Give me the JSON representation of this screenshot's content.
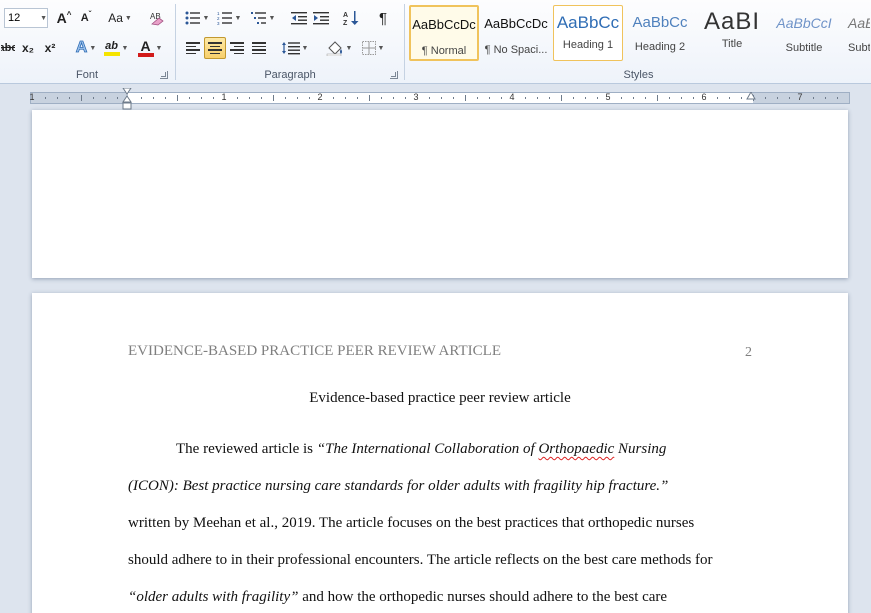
{
  "ribbon": {
    "font_group": {
      "label": "Font",
      "font_size": "12",
      "grow_font": "A",
      "shrink_font": "A",
      "change_case": "Aa",
      "strikethrough": "abc",
      "subscript": "x₂",
      "superscript": "x²",
      "text_effects": "A",
      "highlight": "ab",
      "font_color": "A",
      "highlight_color": "#f5e400",
      "font_color_value": "#d21b1b"
    },
    "paragraph_group": {
      "label": "Paragraph",
      "pilcrow": "¶"
    },
    "styles_group": {
      "label": "Styles",
      "styles": [
        {
          "sample": "AaBbCcDc",
          "name": "¶ Normal"
        },
        {
          "sample": "AaBbCcDc",
          "name": "¶ No Spaci..."
        },
        {
          "sample": "AaBbCc",
          "name": "Heading 1"
        },
        {
          "sample": "AaBbCc",
          "name": "Heading 2"
        },
        {
          "sample": "AaBI",
          "name": "Title"
        },
        {
          "sample": "AaBbCcI",
          "name": "Subtitle"
        },
        {
          "sample": "AaBl",
          "name": "Subt"
        }
      ]
    }
  },
  "ruler": {
    "numbers": [
      "1",
      "1",
      "2",
      "3",
      "4",
      "5",
      "6",
      "7"
    ]
  },
  "document": {
    "header": "EVIDENCE-BASED PRACTICE PEER REVIEW ARTICLE",
    "page_number": "2",
    "title": "Evidence-based practice peer review article",
    "lines": {
      "l1_a": "The reviewed article is ",
      "l1_b": "“The International  Collaboration of ",
      "l1_c": "Orthopaedic",
      "l1_d": " Nursing",
      "l2": "(ICON): Best practice nursing care standards for older adults with fragility  hip fracture.”",
      "l3": "written by Meehan et al., 2019. The article focuses on the best practices that orthopedic nurses",
      "l4": "should adhere to in their professional encounters. The article reflects on the best care methods for",
      "l5_a": "“older adults with fragility”",
      "l5_b": "  and how the orthopedic nurses should adhere to the best care"
    }
  }
}
